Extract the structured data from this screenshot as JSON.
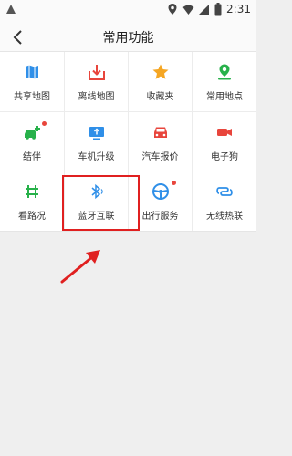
{
  "status_bar": {
    "time": "2:31"
  },
  "header": {
    "title": "常用功能"
  },
  "functions": [
    {
      "label": "共享地图",
      "icon": "map-icon"
    },
    {
      "label": "离线地图",
      "icon": "download-icon"
    },
    {
      "label": "收藏夹",
      "icon": "star-icon"
    },
    {
      "label": "常用地点",
      "icon": "location-pin-icon"
    },
    {
      "label": "结伴",
      "icon": "car-companion-icon",
      "badge": true
    },
    {
      "label": "车机升级",
      "icon": "upgrade-icon"
    },
    {
      "label": "汽车报价",
      "icon": "car-quote-icon"
    },
    {
      "label": "电子狗",
      "icon": "camera-icon"
    },
    {
      "label": "看路况",
      "icon": "traffic-grid-icon"
    },
    {
      "label": "蓝牙互联",
      "icon": "bluetooth-icon"
    },
    {
      "label": "出行服务",
      "icon": "steering-wheel-icon",
      "badge": true
    },
    {
      "label": "无线热联",
      "icon": "wireless-link-icon"
    }
  ],
  "colors": {
    "blue": "#2f8fe8",
    "red": "#e8453c",
    "orange": "#f5a623",
    "green": "#27b14a",
    "badge": "#e8453c",
    "highlight": "#e02020"
  }
}
